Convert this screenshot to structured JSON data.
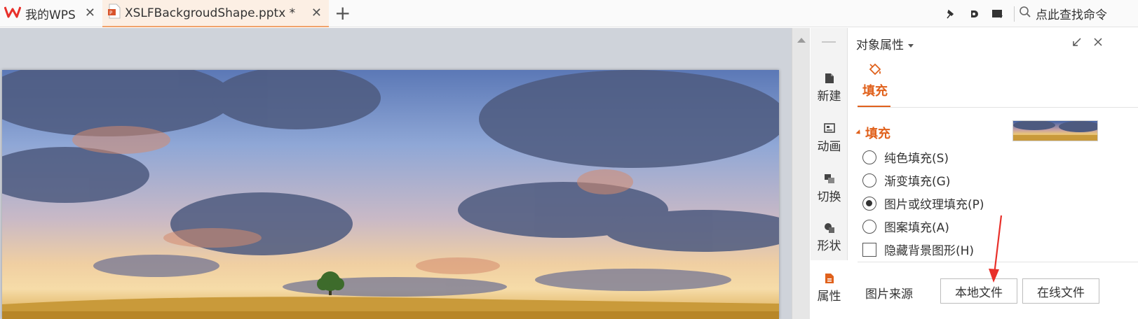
{
  "tabs": [
    {
      "label": "我的WPS",
      "close": "✕",
      "icon": "wps-logo-icon"
    },
    {
      "label": "XSLFBackgroudShape.pptx *",
      "close": "✕",
      "icon": "pptx-file-icon",
      "active": true
    }
  ],
  "new_tab": "+",
  "toolbar_right": {
    "icons": [
      "pin-icon",
      "skin-icon",
      "inbox-icon"
    ],
    "search_label": "点此查找命令"
  },
  "side_strip": [
    {
      "label": "新建",
      "icon": "new-file-icon"
    },
    {
      "label": "动画",
      "icon": "animation-icon"
    },
    {
      "label": "切换",
      "icon": "transition-icon"
    },
    {
      "label": "形状",
      "icon": "shape-icon"
    },
    {
      "label": "属性",
      "icon": "properties-icon",
      "active": true
    }
  ],
  "panel": {
    "title": "对象属性",
    "fill_tab_label": "填充",
    "section_label": "填充",
    "options": [
      {
        "label": "纯色填充(S)",
        "type": "radio",
        "checked": false
      },
      {
        "label": "渐变填充(G)",
        "type": "radio",
        "checked": false
      },
      {
        "label": "图片或纹理填充(P)",
        "type": "radio",
        "checked": true
      },
      {
        "label": "图案填充(A)",
        "type": "radio",
        "checked": false
      },
      {
        "label": "隐藏背景图形(H)",
        "type": "checkbox",
        "checked": false
      }
    ],
    "source_label": "图片来源",
    "local_file_button": "本地文件",
    "online_file_button": "在线文件"
  },
  "colors": {
    "accent": "#e0611c",
    "active_tab_bg": "#fcefe4",
    "annotation_arrow": "#e8302a"
  }
}
